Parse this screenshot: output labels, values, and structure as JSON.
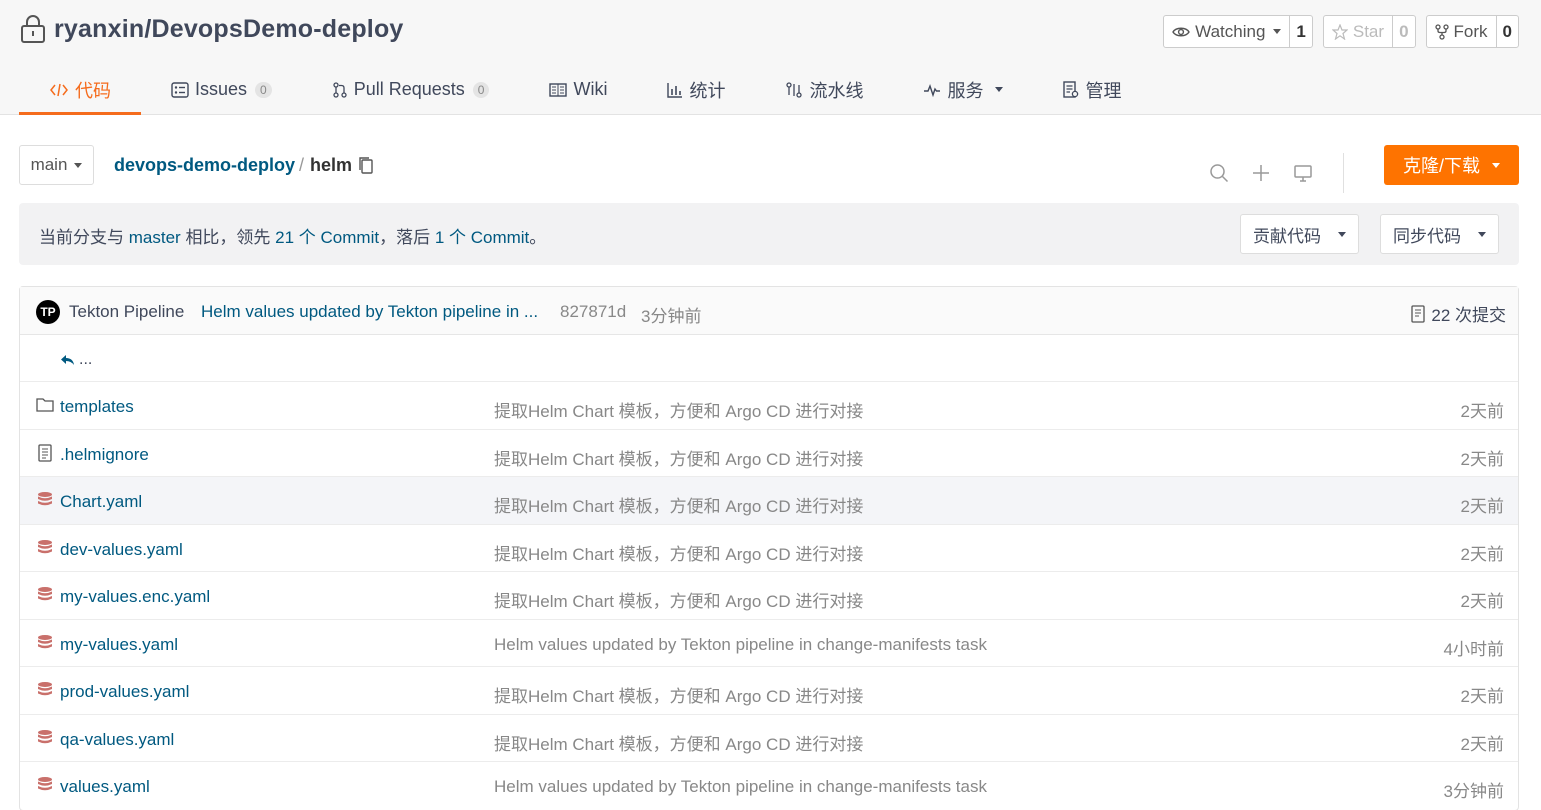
{
  "repo": {
    "title": "ryanxin/DevopsDemo-deploy",
    "watch": {
      "label": "Watching",
      "count": "1"
    },
    "star": {
      "label": "Star",
      "count": "0"
    },
    "fork": {
      "label": "Fork",
      "count": "0"
    }
  },
  "tabs": [
    {
      "label": "代码",
      "icon": "code-icon"
    },
    {
      "label": "Issues",
      "badge": "0",
      "icon": "issues-icon"
    },
    {
      "label": "Pull Requests",
      "badge": "0",
      "icon": "pull-request-icon"
    },
    {
      "label": "Wiki",
      "icon": "wiki-icon"
    },
    {
      "label": "统计",
      "icon": "stats-icon"
    },
    {
      "label": "流水线",
      "icon": "pipeline-icon"
    },
    {
      "label": "服务",
      "icon": "services-icon"
    },
    {
      "label": "管理",
      "icon": "manage-icon"
    }
  ],
  "toolbar": {
    "branch": "main",
    "crumb_repo": "devops-demo-deploy",
    "crumb_sep": "/",
    "crumb_dir": "helm",
    "clone_label": "克隆/下载"
  },
  "compare": {
    "prefix": "当前分支与",
    "branch": "master",
    "mid": "相比，领先",
    "ahead": "21 个 Commit",
    "sep": "，落后",
    "behind": "1 个 Commit",
    "end": "。",
    "contribute_label": "贡献代码",
    "sync_label": "同步代码"
  },
  "last_commit": {
    "avatar": "TP",
    "author": "Tekton Pipeline",
    "message": "Helm values updated by Tekton pipeline in ...",
    "sha": "827871d",
    "time": "3分钟前",
    "count": "22 次提交"
  },
  "back": "...",
  "files": [
    {
      "name": "templates",
      "type": "folder",
      "message": "提取Helm Chart 模板，方便和 Argo CD 进行对接",
      "time": "2天前"
    },
    {
      "name": ".helmignore",
      "type": "text",
      "message": "提取Helm Chart 模板，方便和 Argo CD 进行对接",
      "time": "2天前"
    },
    {
      "name": "Chart.yaml",
      "type": "yaml",
      "message": "提取Helm Chart 模板，方便和 Argo CD 进行对接",
      "time": "2天前"
    },
    {
      "name": "dev-values.yaml",
      "type": "yaml",
      "message": "提取Helm Chart 模板，方便和 Argo CD 进行对接",
      "time": "2天前"
    },
    {
      "name": "my-values.enc.yaml",
      "type": "yaml",
      "message": "提取Helm Chart 模板，方便和 Argo CD 进行对接",
      "time": "2天前"
    },
    {
      "name": "my-values.yaml",
      "type": "yaml",
      "message": "Helm values updated by Tekton pipeline in change-manifests task",
      "time": "4小时前"
    },
    {
      "name": "prod-values.yaml",
      "type": "yaml",
      "message": "提取Helm Chart 模板，方便和 Argo CD 进行对接",
      "time": "2天前"
    },
    {
      "name": "qa-values.yaml",
      "type": "yaml",
      "message": "提取Helm Chart 模板，方便和 Argo CD 进行对接",
      "time": "2天前"
    },
    {
      "name": "values.yaml",
      "type": "yaml",
      "message": "Helm values updated by Tekton pipeline in change-manifests task",
      "time": "3分钟前"
    }
  ],
  "colors": {
    "accent": "#fe7300",
    "link": "#005980",
    "yaml_icon": "#c9706b"
  }
}
